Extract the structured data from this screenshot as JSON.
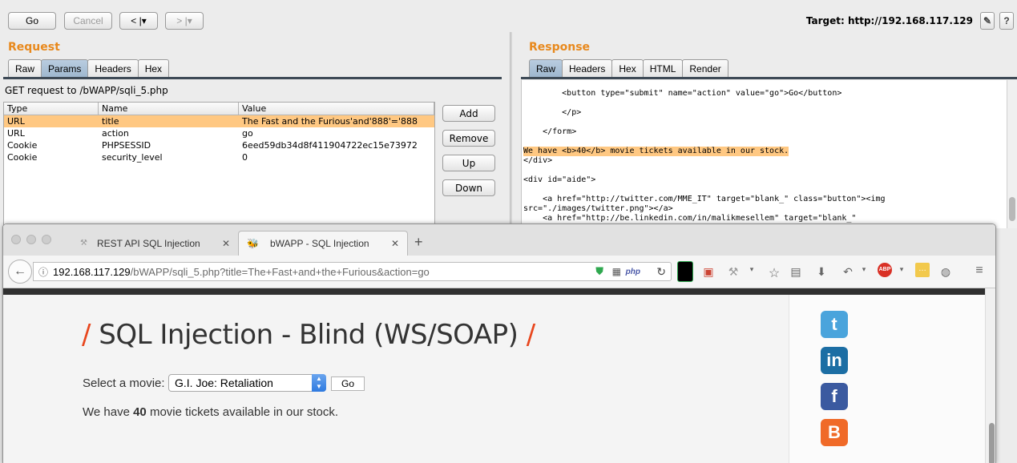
{
  "burp": {
    "toolbar": {
      "go": "Go",
      "cancel": "Cancel",
      "back": "< |▾",
      "forward": "> |▾",
      "target": "Target: http://192.168.117.129"
    },
    "request": {
      "title": "Request",
      "tabs": [
        "Raw",
        "Params",
        "Headers",
        "Hex"
      ],
      "active_tab": "Params",
      "summary": "GET request to /bWAPP/sqli_5.php",
      "columns": [
        "Type",
        "Name",
        "Value"
      ],
      "rows": [
        {
          "type": "URL",
          "name": "title",
          "value": "The Fast and the Furious'and'888'='888"
        },
        {
          "type": "URL",
          "name": "action",
          "value": "go"
        },
        {
          "type": "Cookie",
          "name": "PHPSESSID",
          "value": "6eed59db34d8f411904722ec15e73972"
        },
        {
          "type": "Cookie",
          "name": "security_level",
          "value": "0"
        }
      ],
      "buttons": {
        "add": "Add",
        "remove": "Remove",
        "up": "Up",
        "down": "Down"
      }
    },
    "response": {
      "title": "Response",
      "tabs": [
        "Raw",
        "Headers",
        "Hex",
        "HTML",
        "Render"
      ],
      "active_tab": "Raw",
      "lines": [
        "        <button type=\"submit\" name=\"action\" value=\"go\">Go</button>",
        "        </p>",
        "    </form>",
        "We have <b>40</b> movie tickets available in our stock.",
        "</div>",
        "<div id=\"aide\">",
        "    <a href=\"http://twitter.com/MME_IT\" target=\"blank_\" class=\"button\"><img",
        "src=\"./images/twitter.png\"></a>",
        "    <a href=\"http://be.linkedin.com/in/malikmesellem\" target=\"blank_\""
      ]
    }
  },
  "browser": {
    "tabs": [
      {
        "label": "REST API SQL Injection",
        "active": false
      },
      {
        "label": "bWAPP - SQL Injection",
        "active": true
      }
    ],
    "url_host": "192.168.117.129",
    "url_path": "/bWAPP/sqli_5.php?title=The+Fast+and+the+Furious&action=go",
    "page": {
      "title": "SQL Injection - Blind (WS/SOAP)",
      "slash": "/",
      "select_label": "Select a movie:",
      "selected_movie": "G.I. Joe: Retaliation",
      "go": "Go",
      "stock_prefix": "We have ",
      "stock_count": "40",
      "stock_suffix": " movie tickets available in our stock."
    },
    "social": [
      {
        "name": "twitter",
        "glyph": "t",
        "color": "#4aa4dc"
      },
      {
        "name": "linkedin",
        "glyph": "in",
        "color": "#1c6ea4"
      },
      {
        "name": "facebook",
        "glyph": "f",
        "color": "#3b5aa0"
      },
      {
        "name": "blogger",
        "glyph": "B",
        "color": "#f06a28"
      }
    ]
  }
}
